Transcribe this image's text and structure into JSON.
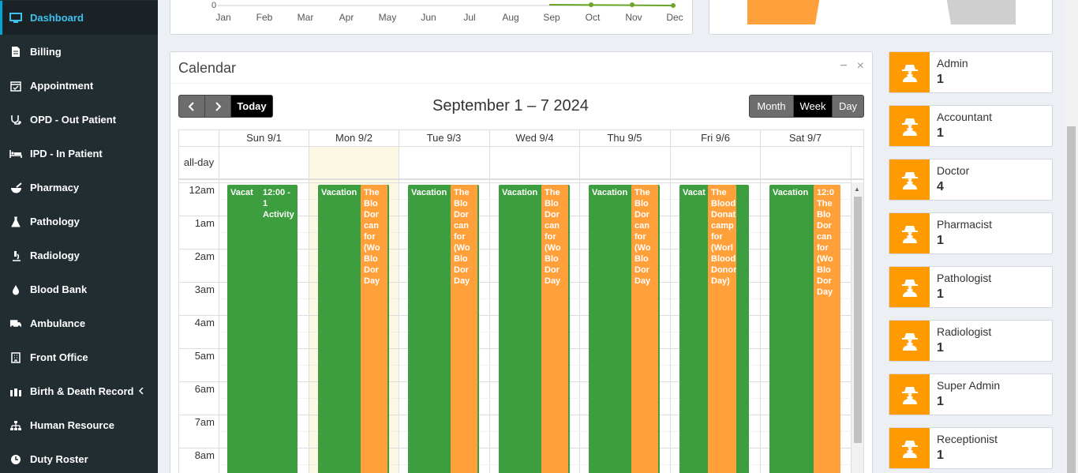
{
  "sidebar": {
    "items": [
      {
        "label": "Dashboard",
        "icon": "monitor-icon"
      },
      {
        "label": "Billing",
        "icon": "file-icon"
      },
      {
        "label": "Appointment",
        "icon": "calendar-check-icon"
      },
      {
        "label": "OPD - Out Patient",
        "icon": "stethoscope-icon"
      },
      {
        "label": "IPD - In Patient",
        "icon": "bed-icon"
      },
      {
        "label": "Pharmacy",
        "icon": "mortar-pestle-icon"
      },
      {
        "label": "Pathology",
        "icon": "flask-icon"
      },
      {
        "label": "Radiology",
        "icon": "microscope-icon"
      },
      {
        "label": "Blood Bank",
        "icon": "tint-icon"
      },
      {
        "label": "Ambulance",
        "icon": "ambulance-icon"
      },
      {
        "label": "Front Office",
        "icon": "building-icon"
      },
      {
        "label": "Birth & Death Record",
        "icon": "family-icon"
      },
      {
        "label": "Human Resource",
        "icon": "sitemap-icon"
      },
      {
        "label": "Duty Roster",
        "icon": "clock-icon"
      }
    ]
  },
  "chart_fragment": {
    "y_tick": "0",
    "months": [
      "Jan",
      "Feb",
      "Mar",
      "Apr",
      "May",
      "Jun",
      "Jul",
      "Aug",
      "Sep",
      "Oct",
      "Nov",
      "Dec"
    ]
  },
  "calendar": {
    "title": "Calendar",
    "range": "September 1 – 7 2024",
    "today_label": "Today",
    "views": [
      "Month",
      "Week",
      "Day"
    ],
    "active_view": "Week",
    "allday_label": "all-day",
    "days": [
      "Sun 9/1",
      "Mon 9/2",
      "Tue 9/3",
      "Wed 9/4",
      "Thu 9/5",
      "Fri 9/6",
      "Sat 9/7"
    ],
    "hours": [
      "12am",
      "1am",
      "2am",
      "3am",
      "4am",
      "5am",
      "6am",
      "7am",
      "8am"
    ],
    "events": {
      "vacation": "Vacation",
      "vacation_short": "Vacat",
      "activity_time": "12:00 - 1",
      "activity": "Activity",
      "blood_lines": [
        "The",
        "Blo",
        "Dor",
        "can",
        "for",
        "(Wo",
        "Blo",
        "Dor",
        "Day"
      ],
      "blood_lines_fri": [
        "The",
        "Blood",
        "Donat",
        "camp",
        "for",
        "(Worl",
        "Blood",
        "Donor",
        "Day)"
      ],
      "blood_lines_sat": [
        "12:0",
        "The",
        "Blo",
        "Dor",
        "can",
        "for",
        "(Wo",
        "Blo",
        "Dor",
        "Day"
      ]
    }
  },
  "staff": [
    {
      "role": "Admin",
      "count": "1"
    },
    {
      "role": "Accountant",
      "count": "1"
    },
    {
      "role": "Doctor",
      "count": "4"
    },
    {
      "role": "Pharmacist",
      "count": "1"
    },
    {
      "role": "Pathologist",
      "count": "1"
    },
    {
      "role": "Radiologist",
      "count": "1"
    },
    {
      "role": "Super Admin",
      "count": "1"
    },
    {
      "role": "Receptionist",
      "count": "1"
    }
  ],
  "colors": {
    "sidebar": "#222d32",
    "accent": "#3cc1f1",
    "event_green": "#3c9e3f",
    "event_orange": "#ffa03a",
    "staff_icon": "#ff9a00"
  }
}
